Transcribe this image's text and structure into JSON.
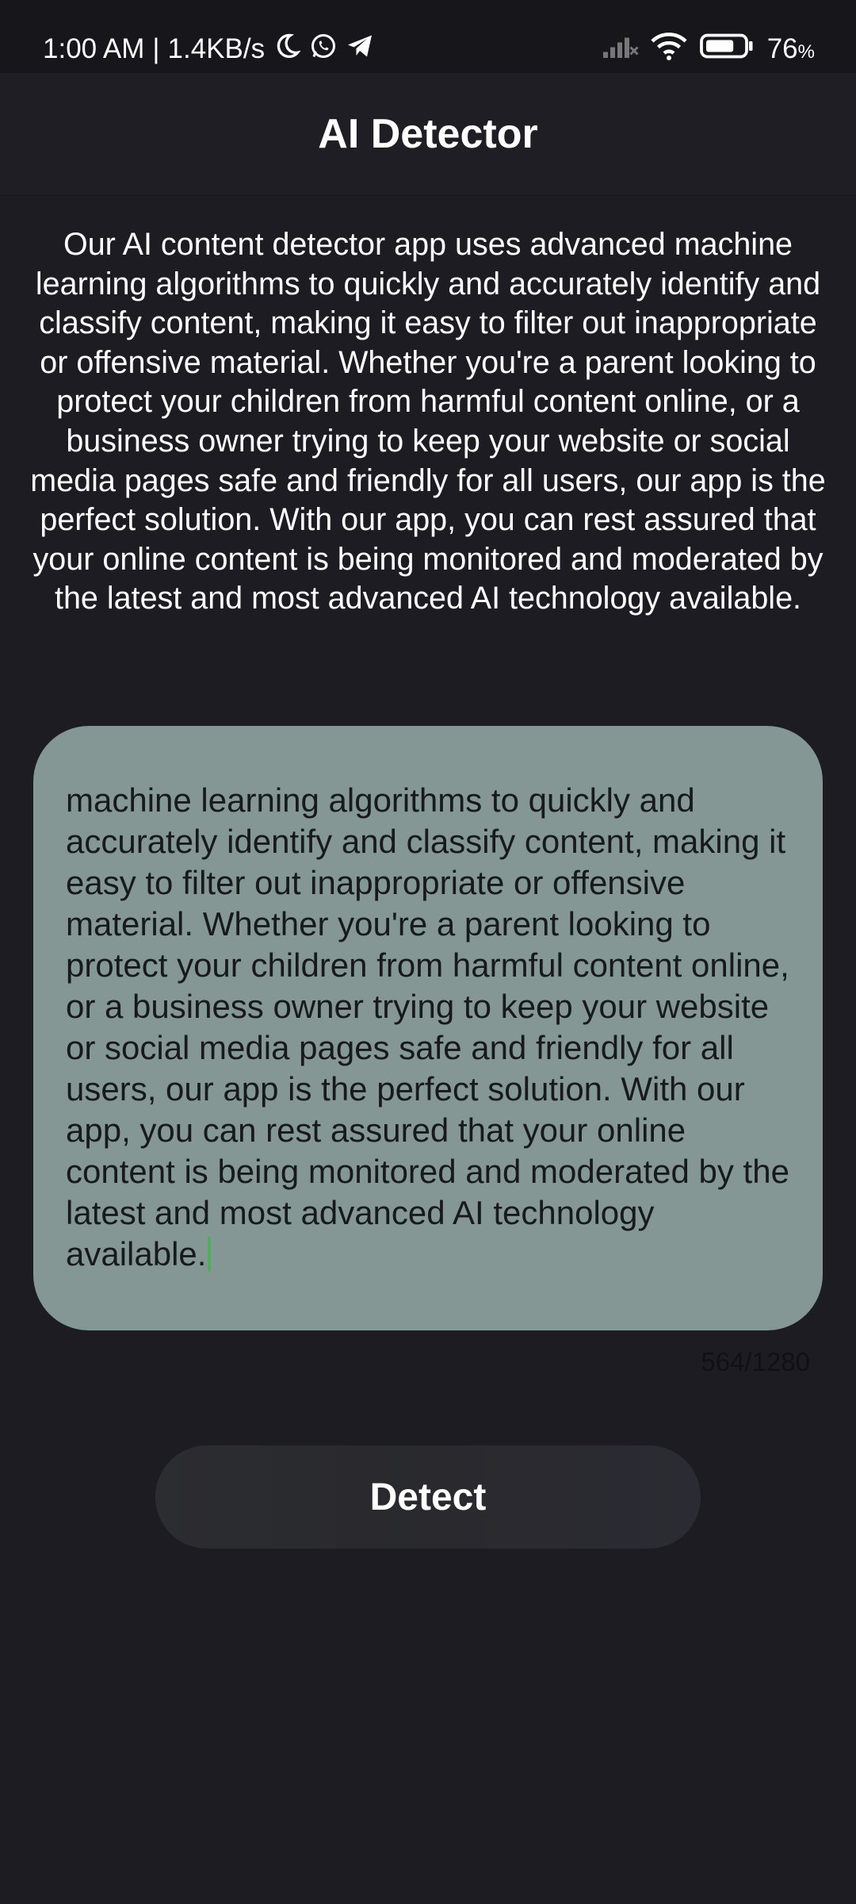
{
  "status_bar": {
    "time": "1:00 AM",
    "separator": "|",
    "network_speed": "1.4KB/s",
    "left_icons": [
      "moon-icon",
      "whatsapp-icon",
      "telegram-icon"
    ],
    "right_icons": [
      "signal-icon",
      "wifi-icon",
      "battery-icon"
    ],
    "battery_level": 76,
    "battery_value": "76",
    "battery_unit": "%"
  },
  "app_bar": {
    "title": "AI Detector"
  },
  "description": "Our AI content detector app uses advanced machine learning algorithms to quickly and accurately identify and classify content, making it easy to filter out inappropriate or offensive material. Whether you're a parent looking to protect your children from harmful content online, or a business owner trying to keep your website or social media pages safe and friendly for all users, our app is the perfect solution. With our app, you can rest assured that your online content is being monitored and moderated by the latest and most advanced AI technology available.",
  "input": {
    "value": "machine learning algorithms to quickly and accurately identify and classify content, making it easy to filter out inappropriate or offensive material. Whether you're a parent looking to protect your children from harmful content online, or a business owner trying to keep your website or social media pages safe and friendly for all users, our app is the perfect solution. With our app, you can rest assured that your online content is being monitored and moderated by the latest and most advanced AI technology available.",
    "char_count": "564/1280"
  },
  "detect_button": {
    "label": "Detect"
  },
  "colors": {
    "background": "#1c1c22",
    "input_card": "#849794",
    "caret": "#4fae5a",
    "text_light": "#ffffff"
  }
}
